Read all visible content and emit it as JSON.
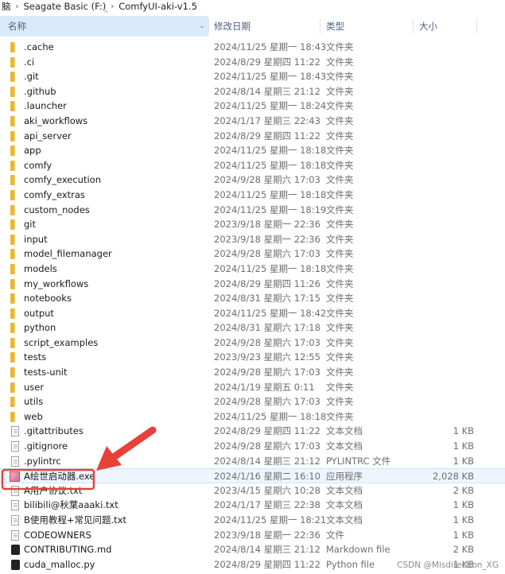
{
  "breadcrumb": [
    "脑",
    "Seagate Basic (F:)",
    "ComfyUI-aki-v1.5"
  ],
  "columns": {
    "name": "名称",
    "date": "修改日期",
    "type": "类型",
    "size": "大小"
  },
  "files": [
    {
      "name": ".cache",
      "date": "2024/11/25 星期一 18:43",
      "type": "文件夹",
      "size": "",
      "icon": "folder-icon"
    },
    {
      "name": ".ci",
      "date": "2024/8/29 星期四 11:22",
      "type": "文件夹",
      "size": "",
      "icon": "folder-icon"
    },
    {
      "name": ".git",
      "date": "2024/11/25 星期一 18:43",
      "type": "文件夹",
      "size": "",
      "icon": "folder-icon"
    },
    {
      "name": ".github",
      "date": "2024/8/14 星期三 21:12",
      "type": "文件夹",
      "size": "",
      "icon": "folder-icon"
    },
    {
      "name": ".launcher",
      "date": "2024/11/25 星期一 18:24",
      "type": "文件夹",
      "size": "",
      "icon": "folder-icon"
    },
    {
      "name": "aki_workflows",
      "date": "2024/1/17 星期三 22:43",
      "type": "文件夹",
      "size": "",
      "icon": "folder-icon"
    },
    {
      "name": "api_server",
      "date": "2024/8/29 星期四 11:22",
      "type": "文件夹",
      "size": "",
      "icon": "folder-icon"
    },
    {
      "name": "app",
      "date": "2024/11/25 星期一 18:18",
      "type": "文件夹",
      "size": "",
      "icon": "folder-icon"
    },
    {
      "name": "comfy",
      "date": "2024/11/25 星期一 18:18",
      "type": "文件夹",
      "size": "",
      "icon": "folder-icon"
    },
    {
      "name": "comfy_execution",
      "date": "2024/9/28 星期六 17:03",
      "type": "文件夹",
      "size": "",
      "icon": "folder-icon"
    },
    {
      "name": "comfy_extras",
      "date": "2024/11/25 星期一 18:18",
      "type": "文件夹",
      "size": "",
      "icon": "folder-icon"
    },
    {
      "name": "custom_nodes",
      "date": "2024/11/25 星期一 18:19",
      "type": "文件夹",
      "size": "",
      "icon": "folder-icon"
    },
    {
      "name": "git",
      "date": "2023/9/18 星期一 22:36",
      "type": "文件夹",
      "size": "",
      "icon": "folder-icon"
    },
    {
      "name": "input",
      "date": "2023/9/18 星期一 22:36",
      "type": "文件夹",
      "size": "",
      "icon": "folder-icon"
    },
    {
      "name": "model_filemanager",
      "date": "2024/9/28 星期六 17:03",
      "type": "文件夹",
      "size": "",
      "icon": "folder-icon"
    },
    {
      "name": "models",
      "date": "2024/11/25 星期一 18:18",
      "type": "文件夹",
      "size": "",
      "icon": "folder-icon"
    },
    {
      "name": "my_workflows",
      "date": "2024/8/29 星期四 11:26",
      "type": "文件夹",
      "size": "",
      "icon": "folder-icon"
    },
    {
      "name": "notebooks",
      "date": "2024/8/31 星期六 17:15",
      "type": "文件夹",
      "size": "",
      "icon": "folder-icon"
    },
    {
      "name": "output",
      "date": "2024/11/25 星期一 18:42",
      "type": "文件夹",
      "size": "",
      "icon": "folder-icon"
    },
    {
      "name": "python",
      "date": "2024/8/31 星期六 17:18",
      "type": "文件夹",
      "size": "",
      "icon": "folder-icon"
    },
    {
      "name": "script_examples",
      "date": "2024/9/28 星期六 17:03",
      "type": "文件夹",
      "size": "",
      "icon": "folder-icon"
    },
    {
      "name": "tests",
      "date": "2023/9/23 星期六 12:55",
      "type": "文件夹",
      "size": "",
      "icon": "folder-icon"
    },
    {
      "name": "tests-unit",
      "date": "2024/9/28 星期六 17:03",
      "type": "文件夹",
      "size": "",
      "icon": "folder-icon"
    },
    {
      "name": "user",
      "date": "2024/1/19 星期五 0:11",
      "type": "文件夹",
      "size": "",
      "icon": "folder-icon"
    },
    {
      "name": "utils",
      "date": "2024/9/28 星期六 17:03",
      "type": "文件夹",
      "size": "",
      "icon": "folder-icon"
    },
    {
      "name": "web",
      "date": "2024/11/25 星期一 18:18",
      "type": "文件夹",
      "size": "",
      "icon": "folder-icon"
    },
    {
      "name": ".gitattributes",
      "date": "2024/8/29 星期四 11:22",
      "type": "文本文档",
      "size": "1 KB",
      "icon": "text-file-icon"
    },
    {
      "name": ".gitignore",
      "date": "2024/9/28 星期六 17:03",
      "type": "文本文档",
      "size": "1 KB",
      "icon": "text-file-icon"
    },
    {
      "name": ".pylintrc",
      "date": "2024/8/14 星期三 21:12",
      "type": "PYLINTRC 文件",
      "size": "1 KB",
      "icon": "file-icon"
    },
    {
      "name": "A绘世启动器.exe",
      "date": "2024/1/16 星期二 16:10",
      "type": "应用程序",
      "size": "2,028 KB",
      "icon": "app-icon"
    },
    {
      "name": "A用户协议.txt",
      "date": "2023/4/15 星期六 10:28",
      "type": "文本文档",
      "size": "2 KB",
      "icon": "text-file-icon"
    },
    {
      "name": "bilibili@秋葉aaaki.txt",
      "date": "2024/1/17 星期三 22:38",
      "type": "文本文档",
      "size": "1 KB",
      "icon": "text-file-icon"
    },
    {
      "name": "B使用教程+常见问题.txt",
      "date": "2024/11/25 星期一 18:21",
      "type": "文本文档",
      "size": "1 KB",
      "icon": "text-file-icon"
    },
    {
      "name": "CODEOWNERS",
      "date": "2023/9/18 星期一 22:36",
      "type": "文件",
      "size": "1 KB",
      "icon": "file-icon"
    },
    {
      "name": "CONTRIBUTING.md",
      "date": "2024/8/14 星期三 21:12",
      "type": "Markdown file",
      "size": "2 KB",
      "icon": "markdown-icon"
    },
    {
      "name": "cuda_malloc.py",
      "date": "2024/8/29 星期四 11:22",
      "type": "Python file",
      "size": "1 KB",
      "icon": "python-icon"
    }
  ],
  "selected_index": 29,
  "watermark": "CSDN @Misdirection_XG",
  "colors": {
    "highlight": "#e8413a",
    "header_bg": "#d9ebfb",
    "folder": "#f7d26b"
  }
}
